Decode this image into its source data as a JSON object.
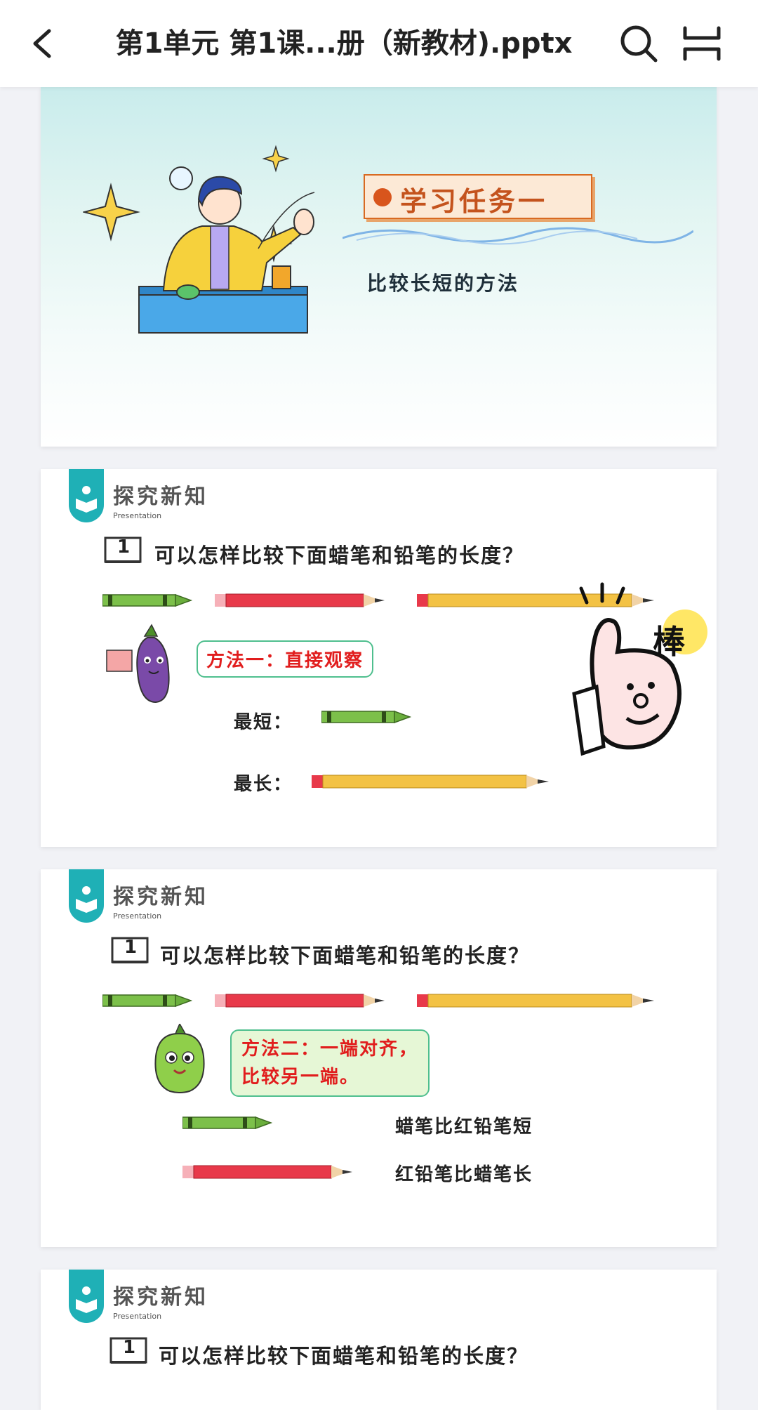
{
  "header": {
    "back_icon": "chevron-left-icon",
    "title": "第1单元 第1课...册（新教材).pptx",
    "search_icon": "search-icon",
    "menu_icon": "menu-icon"
  },
  "slides": [
    {
      "task_title": "学习任务一",
      "task_subtitle": "比较长短的方法"
    },
    {
      "section_title": "探究新知",
      "section_subtitle": "Presentation",
      "question_number": "1",
      "question": "可以怎样比较下面蜡笔和铅笔的长度？",
      "method": "方法一：直接观察",
      "shortest_label": "最短：",
      "longest_label": "最长：",
      "sticker_text": "棒"
    },
    {
      "section_title": "探究新知",
      "section_subtitle": "Presentation",
      "question_number": "1",
      "question": "可以怎样比较下面蜡笔和铅笔的长度？",
      "method_line1": "方法二：一端对齐，",
      "method_line2": "比较另一端。",
      "result1": "蜡笔比红铅笔短",
      "result2": "红铅笔比蜡笔长"
    },
    {
      "section_title": "探究新知",
      "section_subtitle": "Presentation",
      "question_number": "1",
      "question": "可以怎样比较下面蜡笔和铅笔的长度？"
    }
  ],
  "colors": {
    "teal": "#1fb0b6",
    "crayon_green": "#7cc04a",
    "pencil_red": "#e8394a",
    "pencil_yellow": "#f3c244",
    "method_red": "#e11d1d"
  }
}
